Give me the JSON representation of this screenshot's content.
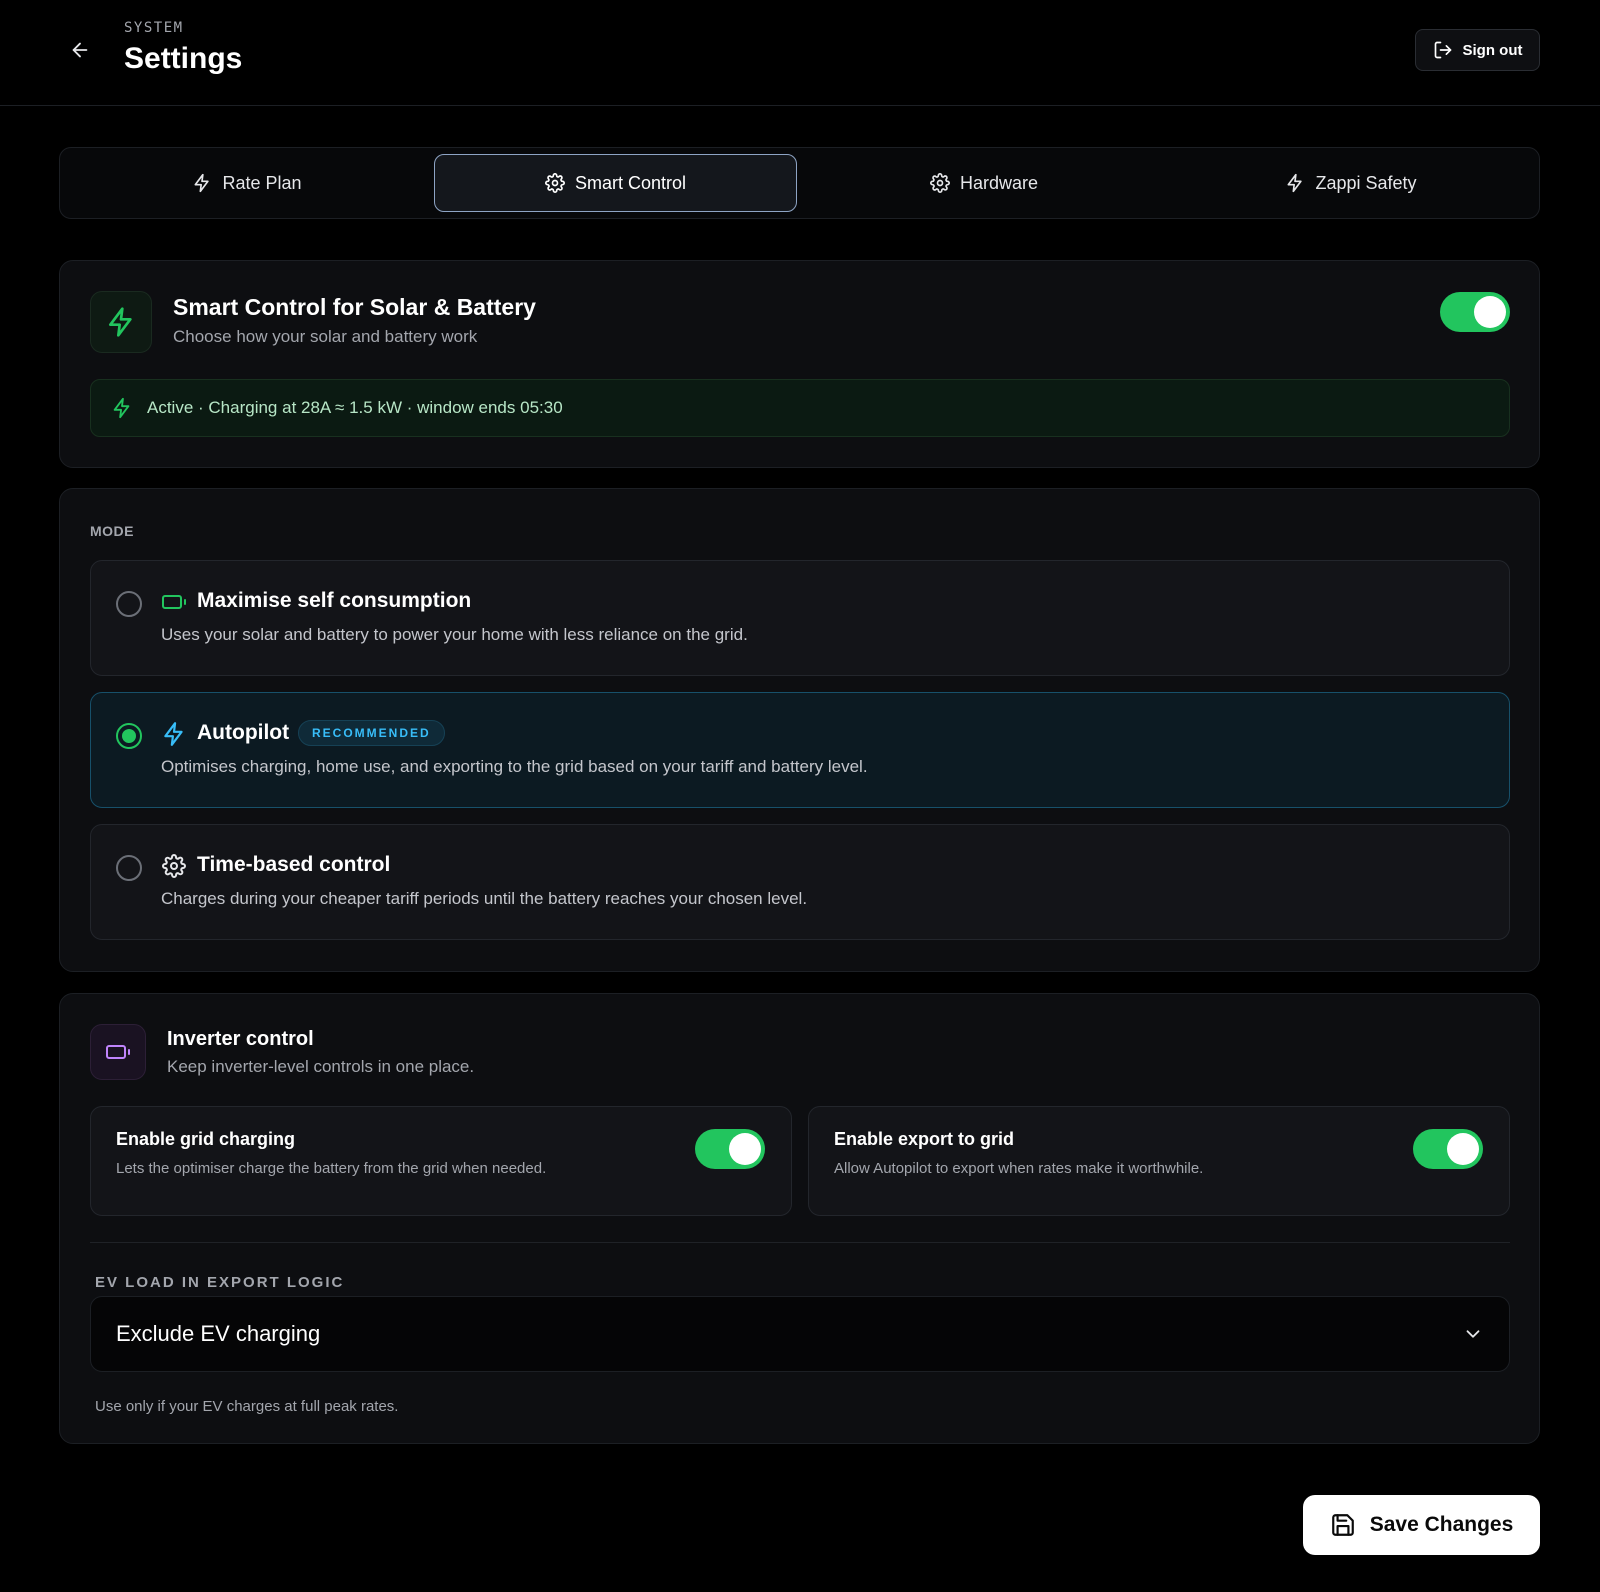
{
  "header": {
    "eyebrow": "SYSTEM",
    "title": "Settings",
    "signout_label": "Sign out"
  },
  "tabs": [
    {
      "label": "Rate Plan",
      "icon": "bolt-icon",
      "active": false
    },
    {
      "label": "Smart Control",
      "icon": "gear-icon",
      "active": true
    },
    {
      "label": "Hardware",
      "icon": "gear-icon",
      "active": false
    },
    {
      "label": "Zappi Safety",
      "icon": "bolt-icon",
      "active": false
    }
  ],
  "smart_control": {
    "title": "Smart Control for Solar & Battery",
    "subtitle": "Choose how your solar and battery work",
    "enabled": true,
    "status": "Active · Charging at 28A ≈ 1.5 kW · window ends 05:30"
  },
  "mode": {
    "label": "MODE",
    "options": [
      {
        "title": "Maximise self consumption",
        "icon": "battery-icon",
        "description": "Uses your solar and battery to power your home with less reliance on the grid.",
        "selected": false
      },
      {
        "title": "Autopilot",
        "icon": "bolt-icon",
        "badge": "RECOMMENDED",
        "description": "Optimises charging, home use, and exporting to the grid based on your tariff and battery level.",
        "selected": true
      },
      {
        "title": "Time-based control",
        "icon": "gear-icon",
        "description": "Charges during your cheaper tariff periods until the battery reaches your chosen level.",
        "selected": false
      }
    ]
  },
  "inverter": {
    "title": "Inverter control",
    "subtitle": "Keep inverter-level controls in one place.",
    "grid_charging": {
      "title": "Enable grid charging",
      "description": "Lets the optimiser charge the battery from the grid when needed.",
      "enabled": true
    },
    "export": {
      "title": "Enable export to grid",
      "description": "Allow Autopilot to export when rates make it worthwhile.",
      "enabled": true
    },
    "ev_label": "EV LOAD IN EXPORT LOGIC",
    "ev_selected": "Exclude EV charging",
    "ev_hint": "Use only if your EV charges at full peak rates."
  },
  "save_label": "Save Changes",
  "colors": {
    "accent_green": "#22c55e",
    "accent_blue": "#38bdf8",
    "accent_purple": "#c084fc",
    "background": "#000000"
  }
}
